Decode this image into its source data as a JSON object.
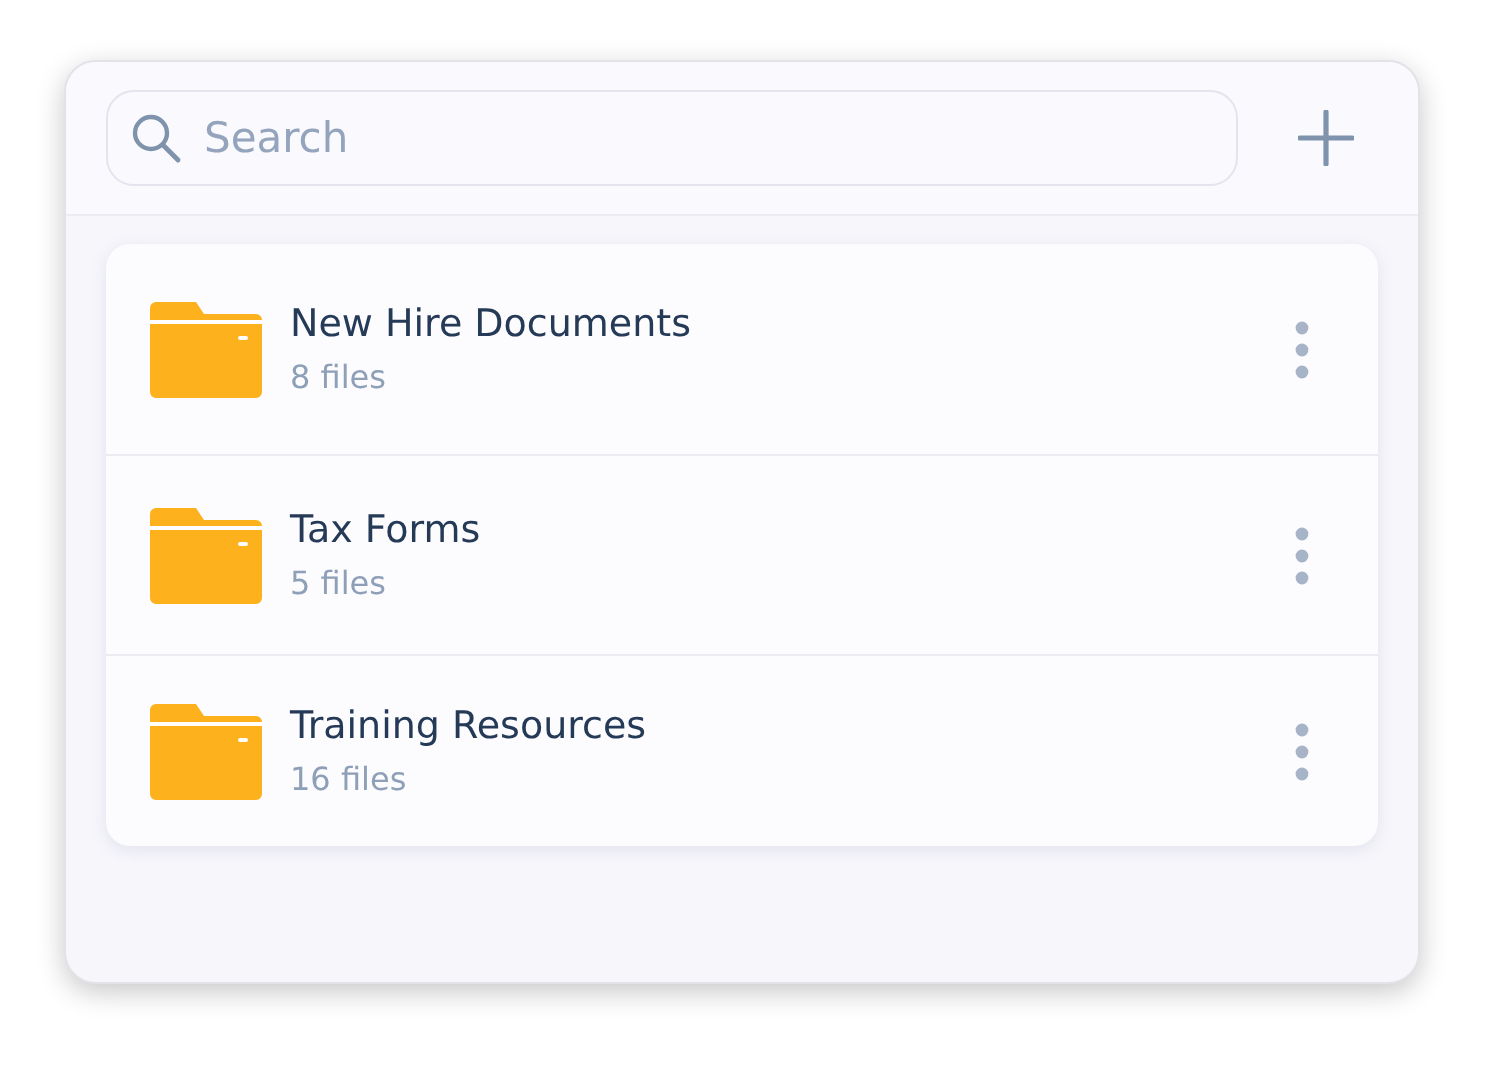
{
  "search": {
    "placeholder": "Search"
  },
  "folders": [
    {
      "name": "New Hire Documents",
      "count": "8 files"
    },
    {
      "name": "Tax Forms",
      "count": "5 files"
    },
    {
      "name": "Training Resources",
      "count": "16 files"
    }
  ]
}
